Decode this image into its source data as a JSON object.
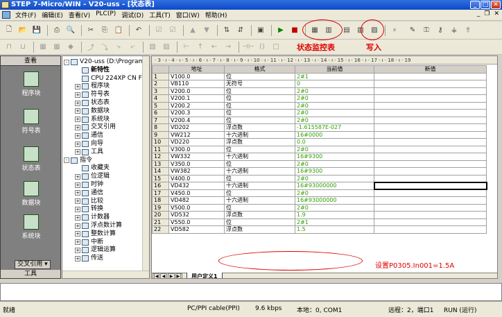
{
  "window": {
    "title": "STEP 7-Micro/WIN - V20-uss - [状态表]"
  },
  "menu": [
    "文件(F)",
    "编辑(E)",
    "查看(V)",
    "PLC(P)",
    "调试(D)",
    "工具(T)",
    "窗口(W)",
    "帮助(H)"
  ],
  "annotations": {
    "status_monitor": "状态监控表",
    "write": "写入",
    "note": "设置P0305.In001=1.5A"
  },
  "navbar": {
    "header": "查看",
    "items": [
      "程序块",
      "符号表",
      "状态表",
      "数据块",
      "系统块",
      "交叉引用"
    ],
    "footer": "工具"
  },
  "tree": [
    {
      "t": "V20-uss (D:\\Program",
      "lvl": 0,
      "pm": "-"
    },
    {
      "t": "新特性",
      "lvl": 1,
      "pm": ""
    },
    {
      "t": "CPU 224XP CN F",
      "lvl": 1,
      "pm": ""
    },
    {
      "t": "程序块",
      "lvl": 1,
      "pm": "+"
    },
    {
      "t": "符号表",
      "lvl": 1,
      "pm": "+"
    },
    {
      "t": "状态表",
      "lvl": 1,
      "pm": "+"
    },
    {
      "t": "数据块",
      "lvl": 1,
      "pm": "+"
    },
    {
      "t": "系统块",
      "lvl": 1,
      "pm": "+"
    },
    {
      "t": "交叉引用",
      "lvl": 1,
      "pm": "+"
    },
    {
      "t": "通信",
      "lvl": 1,
      "pm": "+"
    },
    {
      "t": "向导",
      "lvl": 1,
      "pm": "+"
    },
    {
      "t": "工具",
      "lvl": 1,
      "pm": "+"
    },
    {
      "t": "指令",
      "lvl": 0,
      "pm": "-"
    },
    {
      "t": "收藏夹",
      "lvl": 1,
      "pm": ""
    },
    {
      "t": "位逻辑",
      "lvl": 1,
      "pm": "+"
    },
    {
      "t": "时钟",
      "lvl": 1,
      "pm": "+"
    },
    {
      "t": "通信",
      "lvl": 1,
      "pm": "+"
    },
    {
      "t": "比较",
      "lvl": 1,
      "pm": "+"
    },
    {
      "t": "转换",
      "lvl": 1,
      "pm": "+"
    },
    {
      "t": "计数器",
      "lvl": 1,
      "pm": "+"
    },
    {
      "t": "浮点数计算",
      "lvl": 1,
      "pm": "+"
    },
    {
      "t": "整数计算",
      "lvl": 1,
      "pm": "+"
    },
    {
      "t": "中断",
      "lvl": 1,
      "pm": "+"
    },
    {
      "t": "逻辑运算",
      "lvl": 1,
      "pm": "+"
    },
    {
      "t": "传送",
      "lvl": 1,
      "pm": "+"
    }
  ],
  "ruler": "· 3 · ı · 4 · ı · 5 · ı · 6 · ı · 7 · ı · 8 · ı · 9 · ı · 10 · ı · 11 · ı · 12 · ı · 13 · ı · 14 · ı · 15 · ı · 16 · ı · 17 · ı · 18 · ı · 19",
  "table": {
    "headers": [
      "",
      "地址",
      "格式",
      "当前值",
      "新值"
    ],
    "rows": [
      [
        "1",
        "V100.0",
        "位",
        "2#1",
        ""
      ],
      [
        "2",
        "VB110",
        "无符号",
        "0",
        ""
      ],
      [
        "3",
        "V200.0",
        "位",
        "2#0",
        ""
      ],
      [
        "4",
        "V200.1",
        "位",
        "2#0",
        ""
      ],
      [
        "5",
        "V200.2",
        "位",
        "2#0",
        ""
      ],
      [
        "6",
        "V200.3",
        "位",
        "2#0",
        ""
      ],
      [
        "7",
        "V200.4",
        "位",
        "2#0",
        ""
      ],
      [
        "8",
        "VD202",
        "浮点数",
        "-1.615587E-027",
        ""
      ],
      [
        "9",
        "VW212",
        "十六进制",
        "16#0000",
        ""
      ],
      [
        "10",
        "VD220",
        "浮点数",
        "0.0",
        ""
      ],
      [
        "11",
        "V300.0",
        "位",
        "2#0",
        ""
      ],
      [
        "12",
        "VW332",
        "十六进制",
        "16#9300",
        ""
      ],
      [
        "13",
        "V350.0",
        "位",
        "2#0",
        ""
      ],
      [
        "14",
        "VW382",
        "十六进制",
        "16#9300",
        ""
      ],
      [
        "15",
        "V400.0",
        "位",
        "2#0",
        ""
      ],
      [
        "16",
        "VD432",
        "十六进制",
        "16#93000000",
        ""
      ],
      [
        "17",
        "V450.0",
        "位",
        "2#0",
        ""
      ],
      [
        "18",
        "VD482",
        "十六进制",
        "16#93000000",
        ""
      ],
      [
        "19",
        "V500.0",
        "位",
        "2#0",
        ""
      ],
      [
        "20",
        "VD532",
        "浮点数",
        "1.9",
        ""
      ],
      [
        "21",
        "V550.0",
        "位",
        "2#1",
        ""
      ],
      [
        "22",
        "VD582",
        "浮点数",
        "1.5",
        ""
      ]
    ]
  },
  "tab": "用户定义1",
  "status": {
    "ready": "就绪",
    "cable": "PC/PPI cable(PPI)",
    "baud": "9.6 kbps",
    "local": "本地：0, COM1",
    "remote": "远程：2，端口1",
    "mode": "RUN (运行)"
  },
  "colors": {
    "current_value": "#30a000",
    "annotation": "#e00000"
  }
}
